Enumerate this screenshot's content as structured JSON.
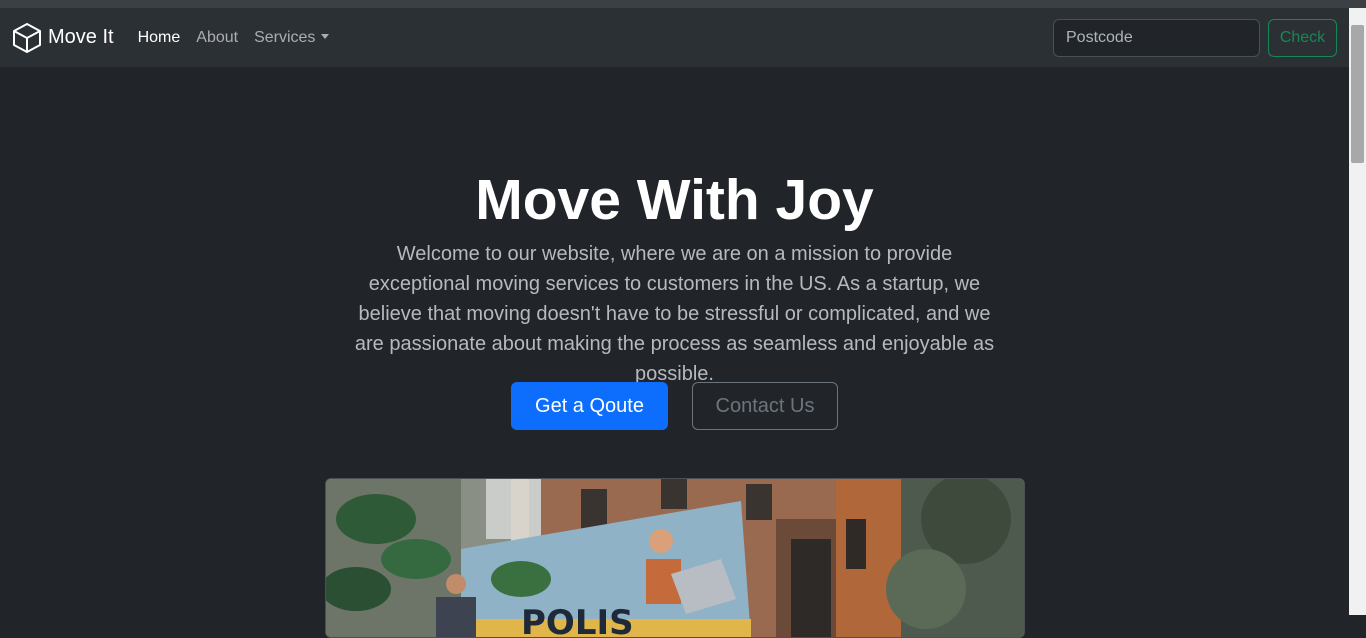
{
  "navbar": {
    "brand": "Move It",
    "links": [
      {
        "label": "Home",
        "active": true
      },
      {
        "label": "About",
        "active": false
      },
      {
        "label": "Services",
        "active": false
      }
    ],
    "search_placeholder": "Postcode",
    "check_label": "Check"
  },
  "hero": {
    "title": "Move With Joy",
    "lead": "Welcome to our website, where we are on a mission to provide exceptional moving services to customers in the US. As a startup, we believe that moving doesn't have to be stressful or complicated, and we are passionate about making the process as seamless and enjoyable as possible.",
    "primary_button": "Get a Qoute",
    "secondary_button": "Contact Us",
    "truck_text": "POLIS"
  },
  "colors": {
    "background": "#212529",
    "navbar": "#2b3035",
    "primary": "#0d6efd",
    "success": "#198754",
    "secondary": "#6c757d"
  },
  "icons": {
    "brand_icon": "box-icon",
    "dropdown_icon": "caret-down-icon"
  }
}
